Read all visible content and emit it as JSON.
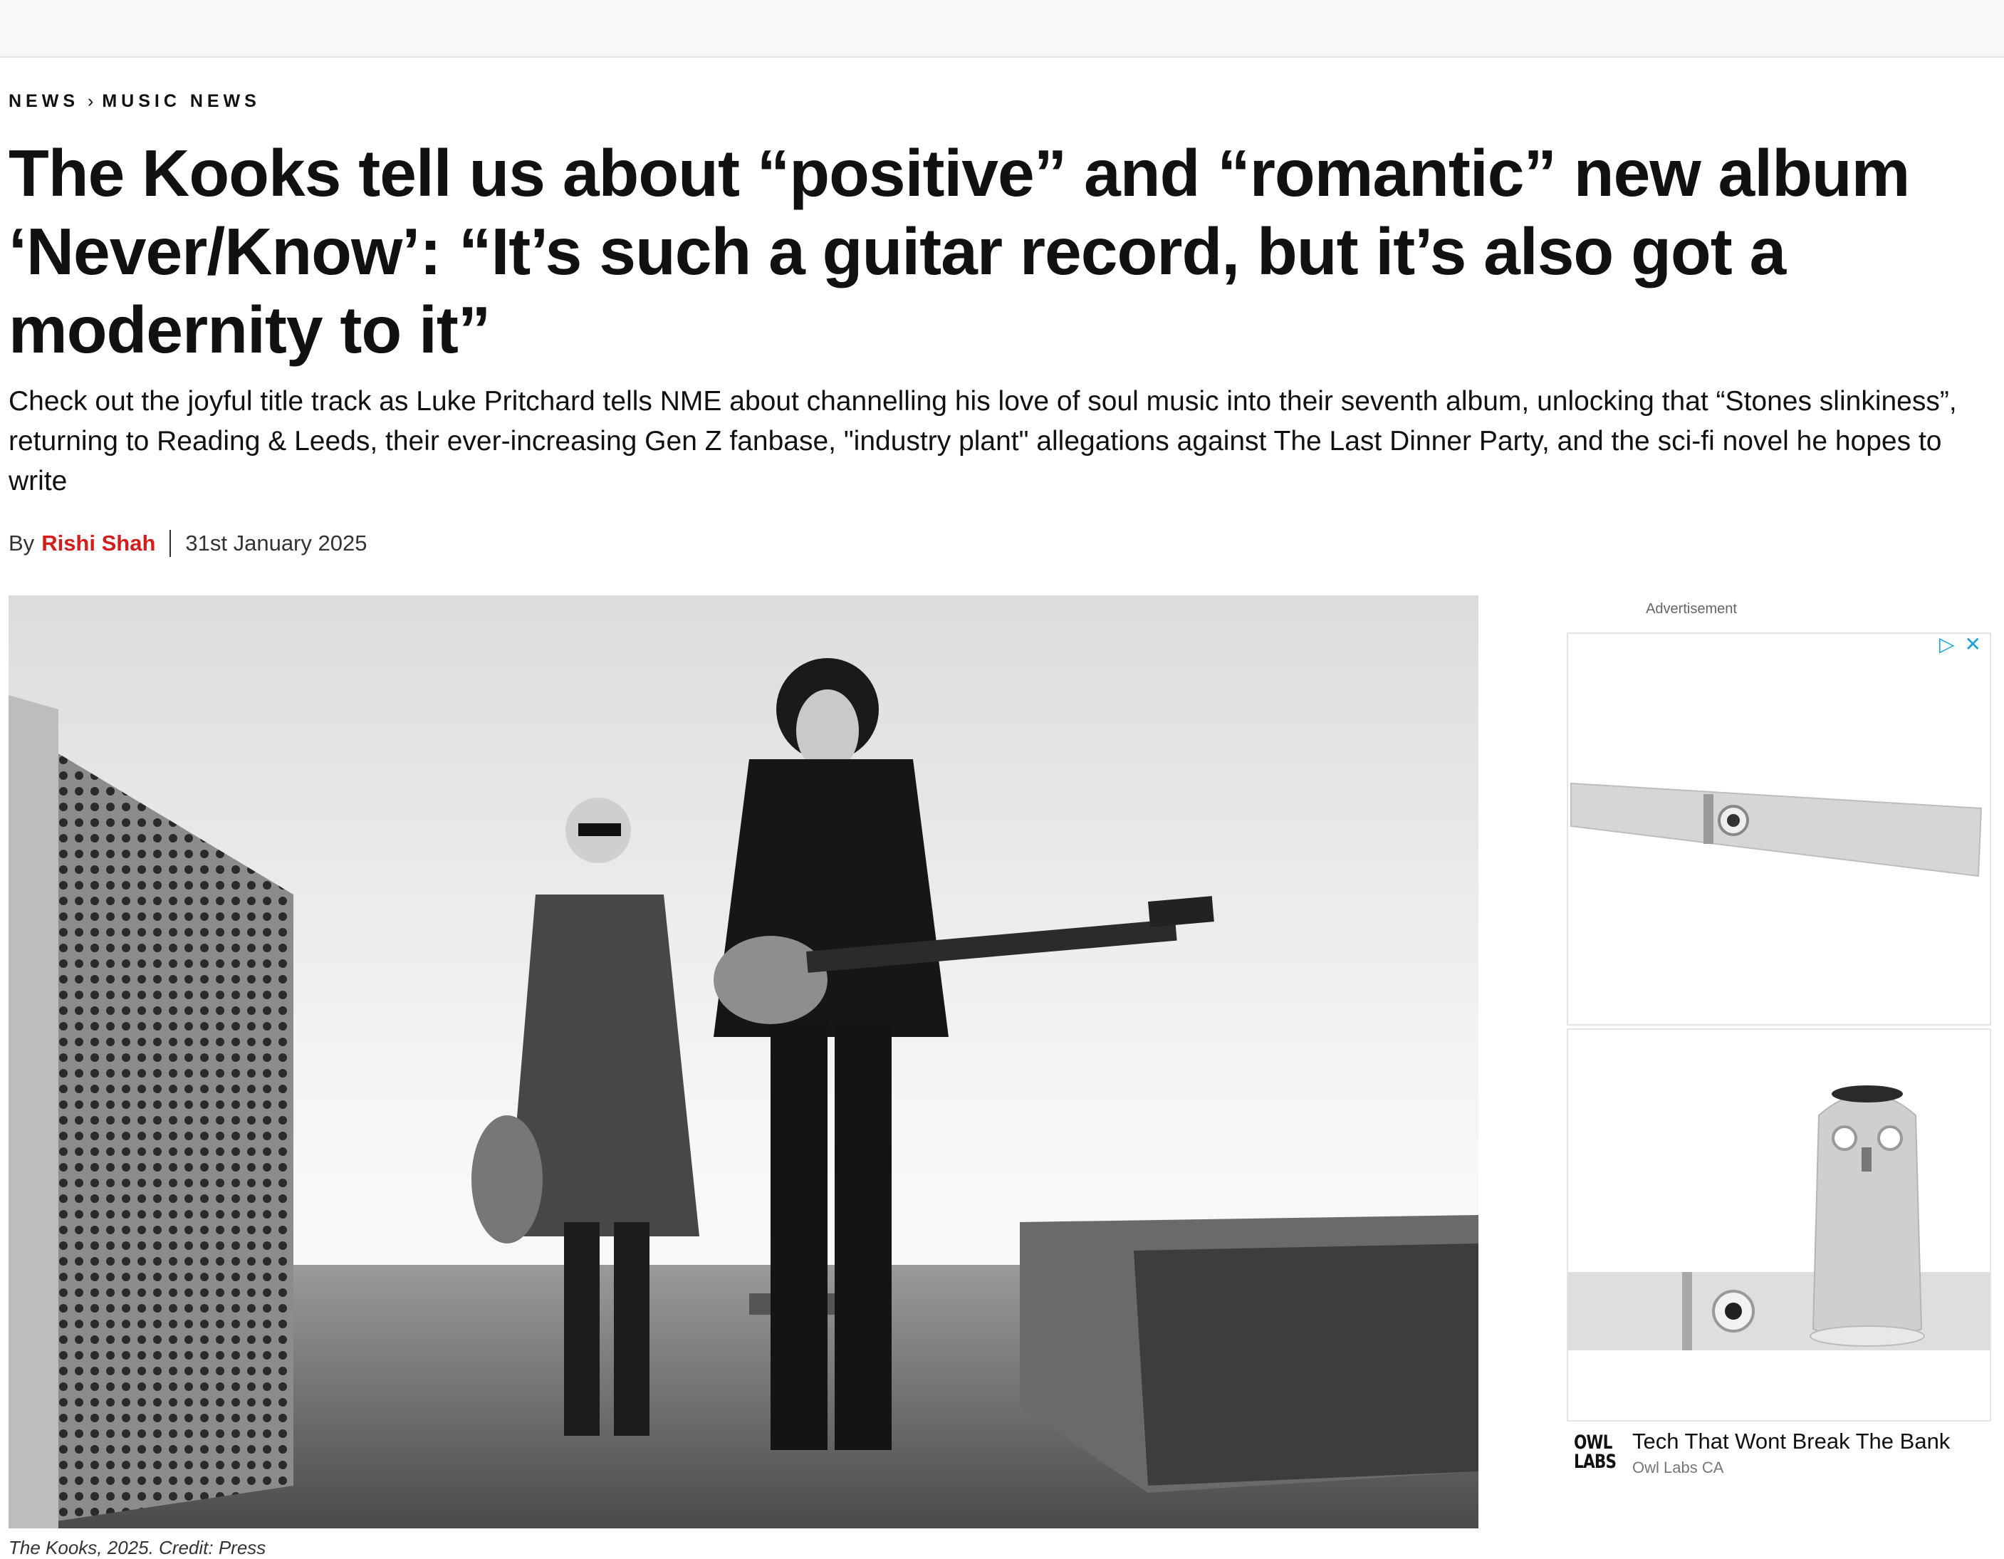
{
  "breadcrumb": {
    "section": "NEWS",
    "separator": "›",
    "subsection": "MUSIC NEWS"
  },
  "article": {
    "headline": "The Kooks tell us about “positive” and “romantic” new album ‘Never/Know’: “It’s such a guitar record, but it’s also got a modernity to it”",
    "standfirst": "Check out the joyful title track as Luke Pritchard tells NME about channelling his love of soul music into their seventh album, unlocking that “Stones slinkiness”, returning to Reading & Leeds, their ever-increasing Gen Z fanbase, \"industry plant\" allegations against The Last Dinner Party, and the sci-fi novel he hopes to write",
    "byline_prefix": "By",
    "author": "Rishi Shah",
    "date": "31st January 2025",
    "image_caption": "The Kooks, 2025. Credit: Press"
  },
  "ad": {
    "label": "Advertisement",
    "adchoices_icon": "play-triangle-icon",
    "close_icon": "close-icon",
    "brand_logo_line1": "OWL",
    "brand_logo_line2": "LABS",
    "title": "Tech That Wont Break The Bank",
    "advertiser": "Owl Labs CA"
  },
  "colors": {
    "author": "#d41d1d",
    "adchoices": "#1aa1d8",
    "topbar": "#f8f8f8"
  }
}
